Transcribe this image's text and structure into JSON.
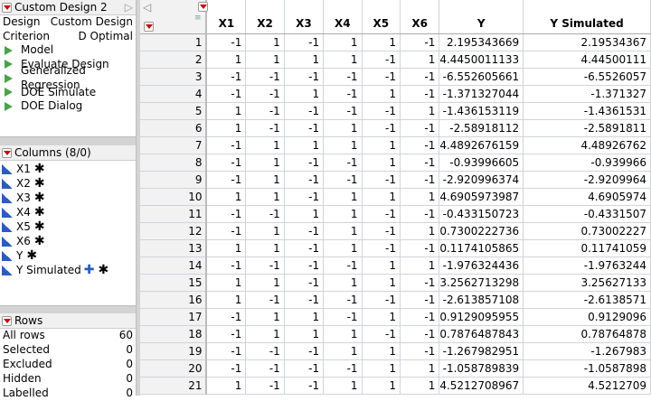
{
  "table_panel": {
    "title": "Custom Design 2",
    "props": [
      {
        "k": "Design",
        "v": "Custom Design"
      },
      {
        "k": "Criterion",
        "v": "D Optimal"
      }
    ],
    "scripts": [
      "Model",
      "Evaluate Design",
      "Generalized Regression",
      "DOE Simulate",
      "DOE Dialog"
    ]
  },
  "columns_panel": {
    "title": "Columns (8/0)",
    "columns": [
      {
        "name": "X1",
        "plus": false
      },
      {
        "name": "X2",
        "plus": false
      },
      {
        "name": "X3",
        "plus": false
      },
      {
        "name": "X4",
        "plus": false
      },
      {
        "name": "X5",
        "plus": false
      },
      {
        "name": "X6",
        "plus": false
      },
      {
        "name": "Y",
        "plus": false
      },
      {
        "name": "Y Simulated",
        "plus": true
      }
    ]
  },
  "rows_panel": {
    "title": "Rows",
    "stats": [
      {
        "k": "All rows",
        "v": "60"
      },
      {
        "k": "Selected",
        "v": "0"
      },
      {
        "k": "Excluded",
        "v": "0"
      },
      {
        "k": "Hidden",
        "v": "0"
      },
      {
        "k": "Labelled",
        "v": "0"
      }
    ]
  },
  "grid": {
    "headers": [
      "X1",
      "X2",
      "X3",
      "X4",
      "X5",
      "X6",
      "Y",
      "Y Simulated"
    ],
    "rows": [
      [
        "1",
        "-1",
        "1",
        "-1",
        "1",
        "1",
        "-1",
        "2.195343669",
        "2.19534367"
      ],
      [
        "2",
        "1",
        "1",
        "1",
        "1",
        "-1",
        "1",
        "4.4450011133",
        "4.44500111"
      ],
      [
        "3",
        "-1",
        "-1",
        "-1",
        "-1",
        "-1",
        "-1",
        "-6.552605661",
        "-6.5526057"
      ],
      [
        "4",
        "-1",
        "-1",
        "1",
        "-1",
        "1",
        "-1",
        "-1.371327044",
        "-1.371327"
      ],
      [
        "5",
        "1",
        "-1",
        "-1",
        "-1",
        "-1",
        "1",
        "-1.436153119",
        "-1.4361531"
      ],
      [
        "6",
        "1",
        "-1",
        "-1",
        "1",
        "-1",
        "-1",
        "-2.58918112",
        "-2.5891811"
      ],
      [
        "7",
        "-1",
        "1",
        "1",
        "1",
        "1",
        "-1",
        "4.4892676159",
        "4.48926762"
      ],
      [
        "8",
        "-1",
        "1",
        "-1",
        "-1",
        "1",
        "-1",
        "-0.93996605",
        "-0.939966"
      ],
      [
        "9",
        "-1",
        "1",
        "-1",
        "-1",
        "-1",
        "-1",
        "-2.920996374",
        "-2.9209964"
      ],
      [
        "10",
        "1",
        "1",
        "-1",
        "1",
        "1",
        "1",
        "4.6905973987",
        "4.6905974"
      ],
      [
        "11",
        "-1",
        "-1",
        "1",
        "1",
        "-1",
        "-1",
        "-0.433150723",
        "-0.4331507"
      ],
      [
        "12",
        "-1",
        "1",
        "-1",
        "1",
        "-1",
        "1",
        "0.7300222736",
        "0.73002227"
      ],
      [
        "13",
        "1",
        "1",
        "-1",
        "1",
        "-1",
        "-1",
        "0.1174105865",
        "0.11741059"
      ],
      [
        "14",
        "-1",
        "-1",
        "-1",
        "-1",
        "1",
        "1",
        "-1.976324436",
        "-1.9763244"
      ],
      [
        "15",
        "1",
        "1",
        "-1",
        "1",
        "1",
        "-1",
        "3.2562713298",
        "3.25627133"
      ],
      [
        "16",
        "1",
        "-1",
        "-1",
        "-1",
        "-1",
        "-1",
        "-2.613857108",
        "-2.6138571"
      ],
      [
        "17",
        "-1",
        "1",
        "1",
        "-1",
        "1",
        "-1",
        "0.9129095955",
        "0.9129096"
      ],
      [
        "18",
        "-1",
        "1",
        "1",
        "1",
        "-1",
        "-1",
        "0.7876487843",
        "0.78764878"
      ],
      [
        "19",
        "-1",
        "-1",
        "-1",
        "1",
        "1",
        "-1",
        "-1.267982951",
        "-1.267983"
      ],
      [
        "20",
        "-1",
        "-1",
        "-1",
        "-1",
        "1",
        "1",
        "-1.058789839",
        "-1.0587898"
      ],
      [
        "21",
        "1",
        "-1",
        "-1",
        "1",
        "1",
        "1",
        "4.5212708967",
        "4.5212709"
      ]
    ]
  }
}
